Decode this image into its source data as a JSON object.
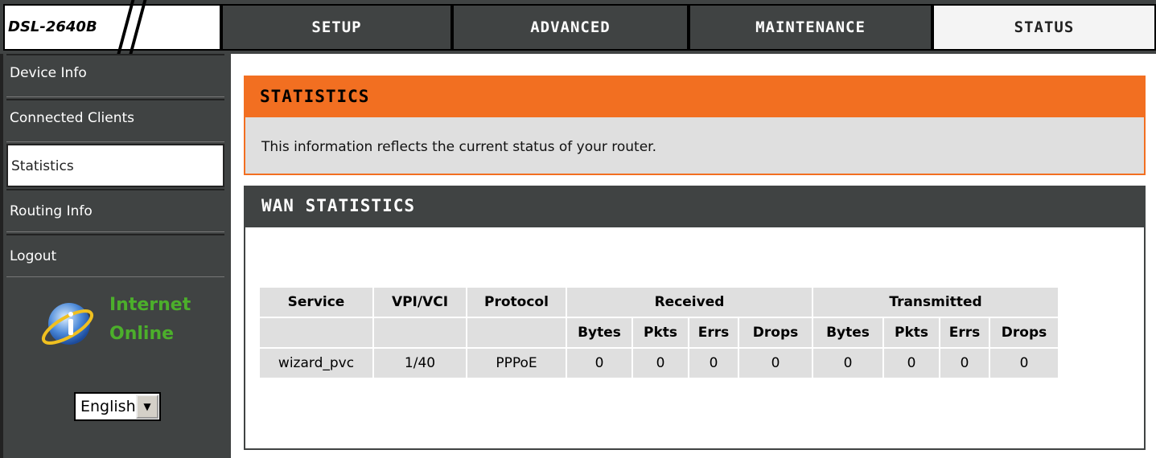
{
  "brand": {
    "model": "DSL-2640B"
  },
  "tabs": [
    {
      "label": "SETUP"
    },
    {
      "label": "ADVANCED"
    },
    {
      "label": "MAINTENANCE"
    },
    {
      "label": "STATUS"
    }
  ],
  "sidebar": {
    "items": [
      {
        "label": "Device Info"
      },
      {
        "label": "Connected Clients"
      },
      {
        "label": "Statistics"
      },
      {
        "label": "Routing Info"
      },
      {
        "label": "Logout"
      }
    ],
    "active_item": "Statistics",
    "status_line1": "Internet",
    "status_line2": "Online",
    "language": "English"
  },
  "statistics": {
    "title": "STATISTICS",
    "description": "This information reflects the current status of your router."
  },
  "wan": {
    "title": "WAN STATISTICS",
    "headers": {
      "service": "Service",
      "vpivci": "VPI/VCI",
      "protocol": "Protocol",
      "received": "Received",
      "transmitted": "Transmitted",
      "bytes": "Bytes",
      "pkts": "Pkts",
      "errs": "Errs",
      "drops": "Drops"
    },
    "row": {
      "service": "wizard_pvc",
      "vpivci": "1/40",
      "protocol": "PPPoE",
      "rx_bytes": "0",
      "rx_pkts": "0",
      "rx_errs": "0",
      "rx_drops": "0",
      "tx_bytes": "0",
      "tx_pkts": "0",
      "tx_errs": "0",
      "tx_drops": "0"
    }
  },
  "colors": {
    "accent": "#f26f21",
    "dark": "#404343",
    "online": "#4caf2b"
  }
}
